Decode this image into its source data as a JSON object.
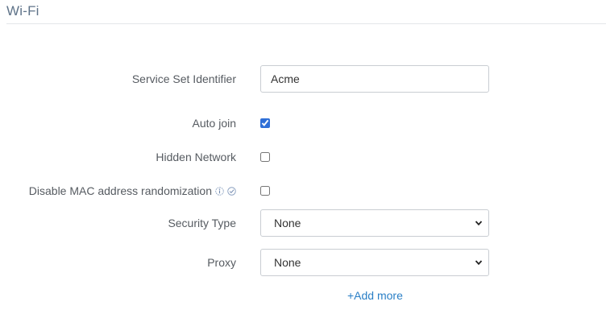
{
  "section": {
    "title": "Wi-Fi"
  },
  "fields": {
    "ssid": {
      "label": "Service Set Identifier",
      "value": "Acme",
      "placeholder": ""
    },
    "auto_join": {
      "label": "Auto join",
      "checked": true
    },
    "hidden_network": {
      "label": "Hidden Network",
      "checked": false
    },
    "disable_mac_randomization": {
      "label": "Disable MAC address randomization",
      "checked": false
    },
    "security_type": {
      "label": "Security Type",
      "selected": "None"
    },
    "proxy": {
      "label": "Proxy",
      "selected": "None"
    }
  },
  "actions": {
    "add_more_label": "+Add more"
  },
  "colors": {
    "accent": "#2a7fc6",
    "title": "#5f7389",
    "checkbox": "#2f6fd7"
  },
  "icons": [
    "info-icon",
    "check-circle-icon",
    "chevron-down-icon"
  ]
}
